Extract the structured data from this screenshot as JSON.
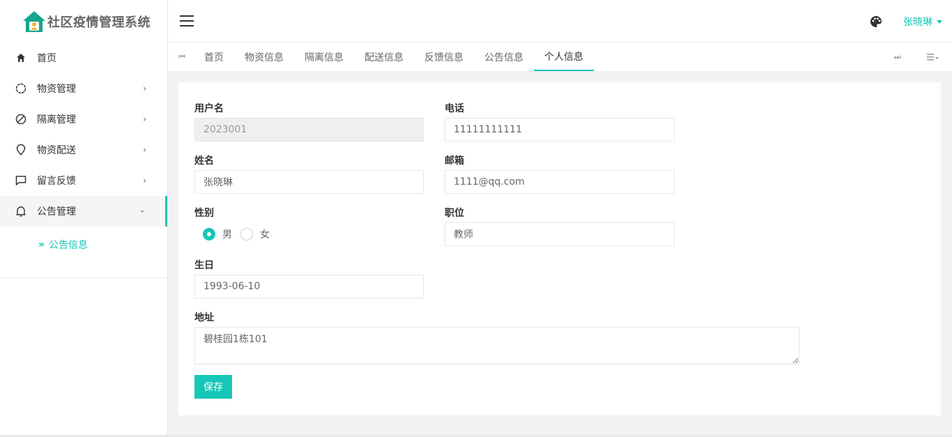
{
  "app": {
    "title": "社区疫情管理系统"
  },
  "sidebar": {
    "items": [
      {
        "label": "首页",
        "icon": "home-icon"
      },
      {
        "label": "物资管理",
        "icon": "circle-icon"
      },
      {
        "label": "隔离管理",
        "icon": "ban-icon"
      },
      {
        "label": "物资配送",
        "icon": "location-icon"
      },
      {
        "label": "留言反馈",
        "icon": "message-icon"
      },
      {
        "label": "公告管理",
        "icon": "bell-icon"
      }
    ],
    "submenu": {
      "label": "公告信息"
    }
  },
  "header": {
    "user": "张晓琳"
  },
  "tabs": [
    {
      "label": "首页"
    },
    {
      "label": "物资信息"
    },
    {
      "label": "隔离信息"
    },
    {
      "label": "配送信息"
    },
    {
      "label": "反馈信息"
    },
    {
      "label": "公告信息"
    },
    {
      "label": "个人信息"
    }
  ],
  "form": {
    "username": {
      "label": "用户名",
      "value": "2023001"
    },
    "phone": {
      "label": "电话",
      "value": "11111111111"
    },
    "name": {
      "label": "姓名",
      "value": "张晓琳"
    },
    "email": {
      "label": "邮箱",
      "value": "1111@qq.com"
    },
    "gender": {
      "label": "性别",
      "options": [
        "男",
        "女"
      ],
      "selected": "男"
    },
    "position": {
      "label": "职位",
      "value": "教师"
    },
    "birthday": {
      "label": "生日",
      "value": "1993-06-10"
    },
    "address": {
      "label": "地址",
      "value": "碧桂园1栋101"
    },
    "save_label": "保存"
  },
  "colors": {
    "accent": "#16c7b7"
  }
}
